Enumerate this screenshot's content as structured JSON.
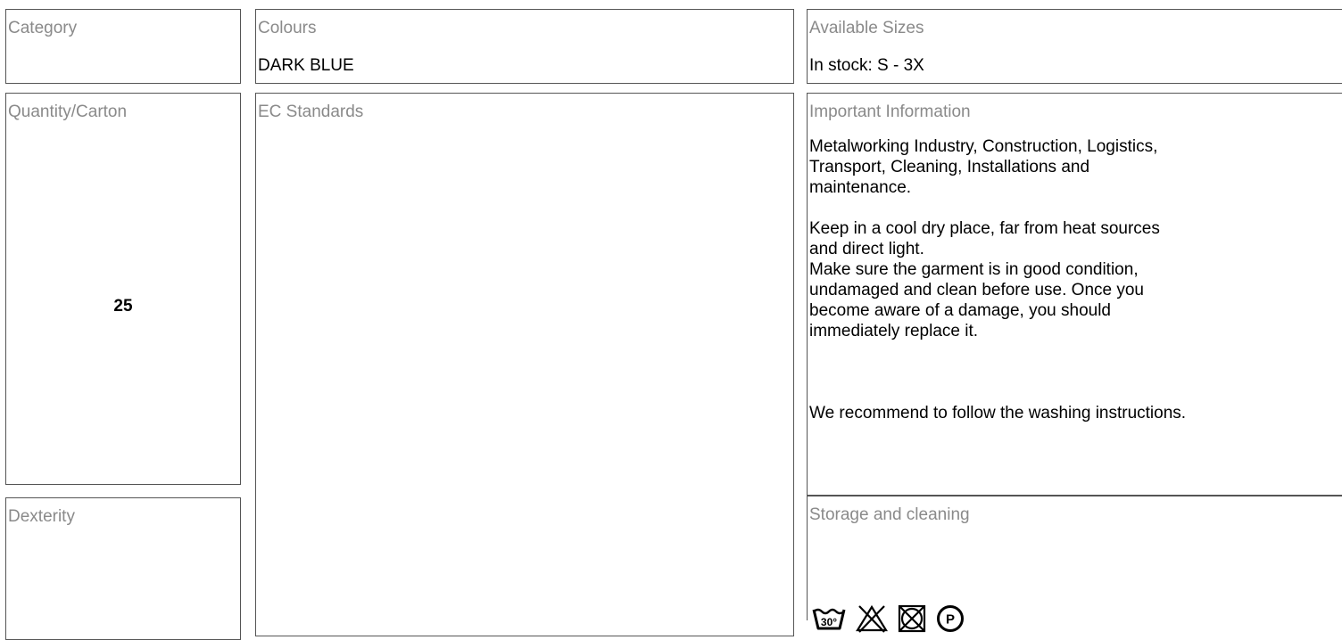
{
  "category": {
    "label": "Category",
    "value": ""
  },
  "colours": {
    "label": "Colours",
    "value": "DARK BLUE"
  },
  "sizes": {
    "label": "Available Sizes",
    "value": "In stock: S - 3X"
  },
  "quantity": {
    "label": "Quantity/Carton",
    "value": "25"
  },
  "standards": {
    "label": "EC Standards"
  },
  "important": {
    "label": "Important Information",
    "para1": [
      "Metalworking Industry, Construction, Logistics,",
      "Transport, Cleaning, Installations and",
      "maintenance."
    ],
    "para2": [
      "Keep in a cool dry place, far from heat sources",
      "and direct light."
    ],
    "para3": [
      "Make sure the garment is in good condition,",
      "undamaged and clean before use. Once you",
      "become aware of a damage, you should",
      "immediately replace it."
    ],
    "para4": [
      "We recommend to follow the washing instructions."
    ]
  },
  "dexterity": {
    "label": "Dexterity"
  },
  "storage": {
    "label": "Storage and cleaning",
    "icons": [
      "wash-30-icon",
      "no-bleach-icon",
      "no-tumble-dry-icon",
      "dry-clean-p-icon"
    ],
    "wash_temp": "30°",
    "dryclean_letter": "P"
  }
}
